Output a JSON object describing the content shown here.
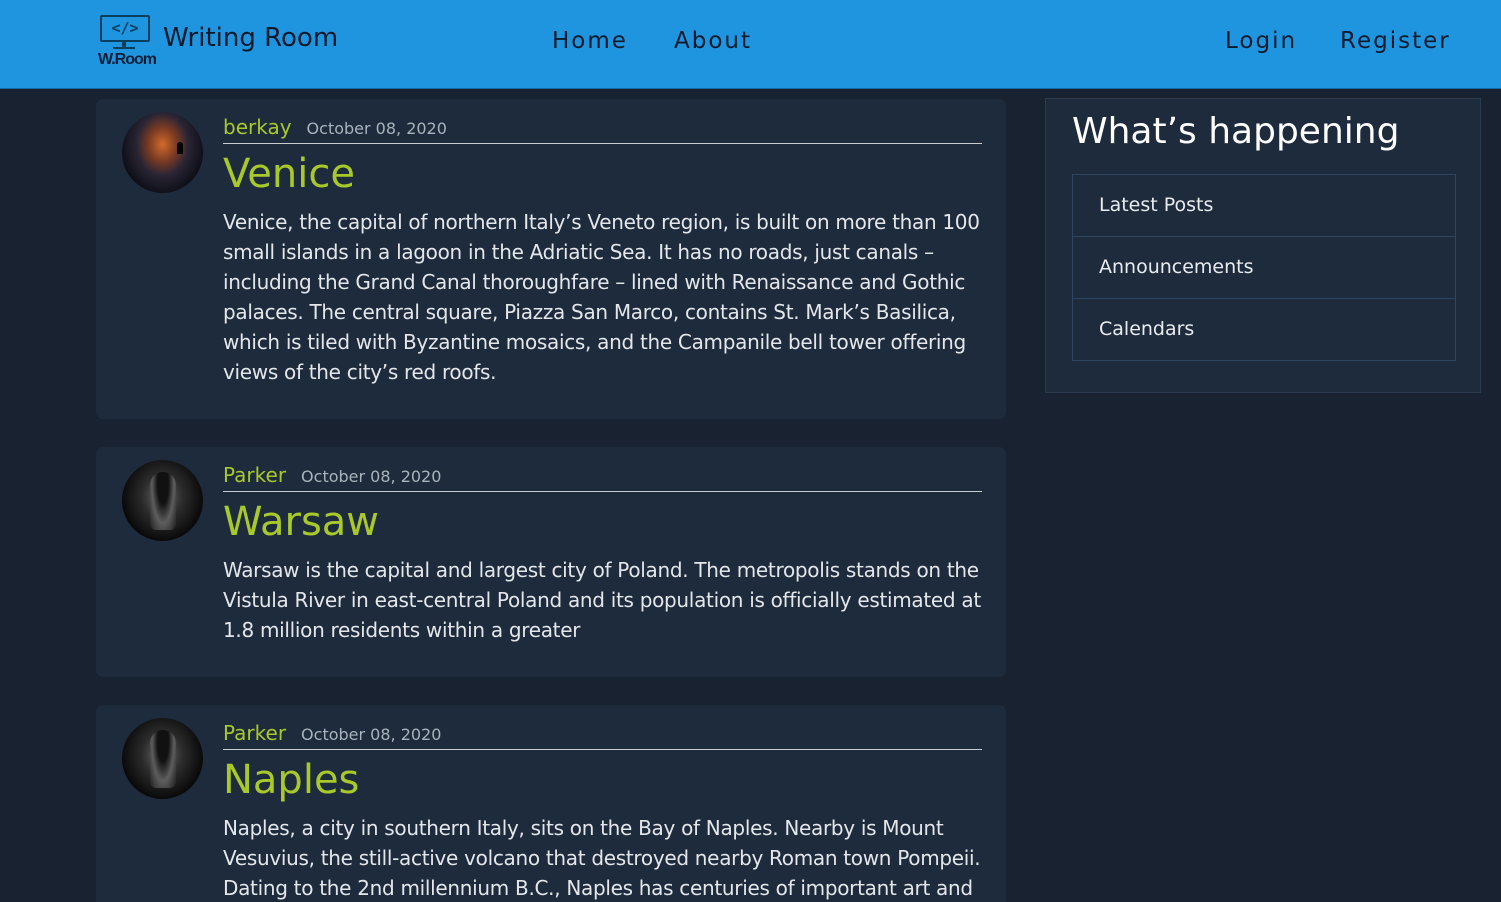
{
  "nav": {
    "brand_name": "Writing Room",
    "logo_glyph": "</>",
    "logo_text": "W.Room",
    "links": {
      "home": "Home",
      "about": "About",
      "login": "Login",
      "register": "Register"
    }
  },
  "posts": [
    {
      "author": "berkay",
      "date": "October 08, 2020",
      "title": "Venice",
      "content": "Venice, the capital of northern Italy’s Veneto region, is built on more than 100 small islands in a lagoon in the Adriatic Sea. It has no roads, just canals – including the Grand Canal thoroughfare – lined with Renaissance and Gothic palaces. The central square, Piazza San Marco, contains St. Mark’s Basilica, which is tiled with Byzantine mosaics, and the Campanile bell tower offering views of the city’s red roofs."
    },
    {
      "author": "Parker",
      "date": "October 08, 2020",
      "title": "Warsaw",
      "content": "Warsaw is the capital and largest city of Poland. The metropolis stands on the Vistula River in east-central Poland and its population is officially estimated at 1.8 million residents within a greater"
    },
    {
      "author": "Parker",
      "date": "October 08, 2020",
      "title": "Naples",
      "content": "Naples, a city in southern Italy, sits on the Bay of Naples. Nearby is Mount Vesuvius, the still-active volcano that destroyed nearby Roman town Pompeii. Dating to the 2nd millennium B.C., Naples has centuries of important art and"
    }
  ],
  "sidebar": {
    "title": "What’s happening",
    "items": [
      "Latest Posts",
      "Announcements",
      "Calendars"
    ]
  },
  "colors": {
    "navbar": "#1f94df",
    "background": "#182230",
    "card": "#1e2b3d",
    "accent": "#a8c92a"
  }
}
